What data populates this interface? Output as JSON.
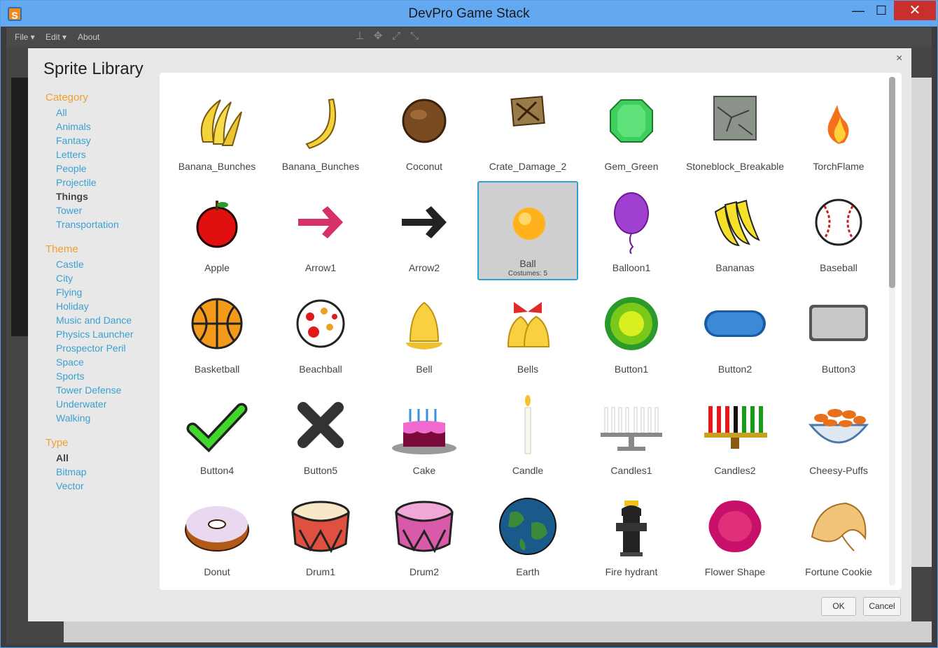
{
  "window": {
    "title": "DevPro Game Stack",
    "minimize": "—",
    "maximize": "☐",
    "close": "✕"
  },
  "menu": {
    "file": "File ▾",
    "edit": "Edit ▾",
    "about": "About"
  },
  "dialog": {
    "title": "Sprite Library",
    "close": "×",
    "ok_label": "OK",
    "cancel_label": "Cancel"
  },
  "sidebar": {
    "category_title": "Category",
    "categories": [
      "All",
      "Animals",
      "Fantasy",
      "Letters",
      "People",
      "Projectile",
      "Things",
      "Tower",
      "Transportation"
    ],
    "category_selected": "Things",
    "theme_title": "Theme",
    "themes": [
      "Castle",
      "City",
      "Flying",
      "Holiday",
      "Music and Dance",
      "Physics Launcher",
      "Prospector Peril",
      "Space",
      "Sports",
      "Tower Defense",
      "Underwater",
      "Walking"
    ],
    "type_title": "Type",
    "types": [
      "All",
      "Bitmap",
      "Vector"
    ],
    "type_selected": "All"
  },
  "sprites": [
    {
      "name": "Banana_Bunches",
      "icon": "banana-bunch-icon"
    },
    {
      "name": "Banana_Bunches",
      "icon": "banana-icon"
    },
    {
      "name": "Coconut",
      "icon": "coconut-icon"
    },
    {
      "name": "Crate_Damage_2",
      "icon": "crate-icon"
    },
    {
      "name": "Gem_Green",
      "icon": "gem-icon"
    },
    {
      "name": "Stoneblock_Breakable",
      "icon": "stoneblock-icon"
    },
    {
      "name": "TorchFlame",
      "icon": "flame-icon"
    },
    {
      "name": "Apple",
      "icon": "apple-icon"
    },
    {
      "name": "Arrow1",
      "icon": "arrow-pink-icon"
    },
    {
      "name": "Arrow2",
      "icon": "arrow-black-icon"
    },
    {
      "name": "Ball",
      "icon": "ball-icon",
      "selected": true,
      "sub": "Costumes: 5"
    },
    {
      "name": "Balloon1",
      "icon": "balloon-icon"
    },
    {
      "name": "Bananas",
      "icon": "bananas-icon"
    },
    {
      "name": "Baseball",
      "icon": "baseball-icon"
    },
    {
      "name": "Basketball",
      "icon": "basketball-icon"
    },
    {
      "name": "Beachball",
      "icon": "beachball-icon"
    },
    {
      "name": "Bell",
      "icon": "bell-icon"
    },
    {
      "name": "Bells",
      "icon": "bells-icon"
    },
    {
      "name": "Button1",
      "icon": "button-round-icon"
    },
    {
      "name": "Button2",
      "icon": "button-pill-icon"
    },
    {
      "name": "Button3",
      "icon": "button-rect-icon"
    },
    {
      "name": "Button4",
      "icon": "checkmark-icon"
    },
    {
      "name": "Button5",
      "icon": "x-mark-icon"
    },
    {
      "name": "Cake",
      "icon": "cake-icon"
    },
    {
      "name": "Candle",
      "icon": "candle-icon"
    },
    {
      "name": "Candles1",
      "icon": "menorah-icon"
    },
    {
      "name": "Candles2",
      "icon": "kinara-icon"
    },
    {
      "name": "Cheesy-Puffs",
      "icon": "cheesy-puffs-icon"
    },
    {
      "name": "Donut",
      "icon": "donut-icon"
    },
    {
      "name": "Drum1",
      "icon": "drum-red-icon"
    },
    {
      "name": "Drum2",
      "icon": "drum-pink-icon"
    },
    {
      "name": "Earth",
      "icon": "earth-icon"
    },
    {
      "name": "Fire hydrant",
      "icon": "fire-hydrant-icon"
    },
    {
      "name": "Flower Shape",
      "icon": "flower-shape-icon"
    },
    {
      "name": "Fortune Cookie",
      "icon": "fortune-cookie-icon"
    }
  ],
  "scroll_position": 0
}
